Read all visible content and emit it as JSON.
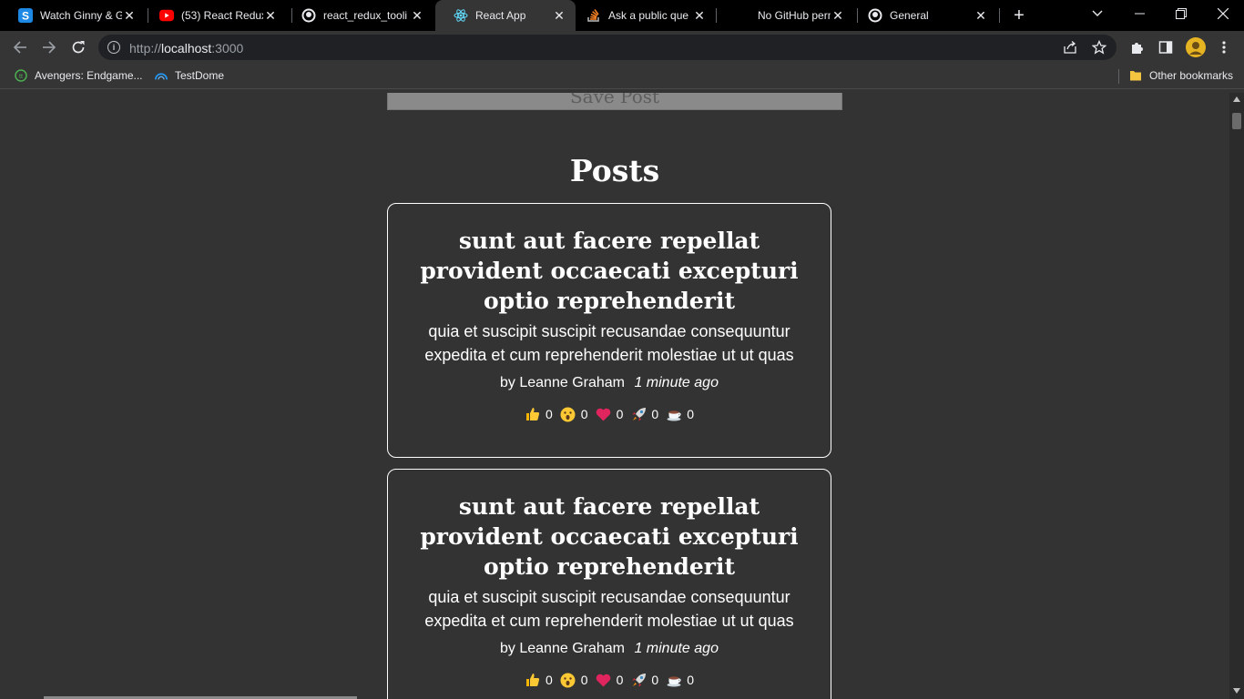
{
  "tabs": [
    {
      "title": "Watch Ginny & G",
      "icon": "s-logo-icon",
      "active": false
    },
    {
      "title": "(53) React Redux",
      "icon": "youtube-icon",
      "active": false
    },
    {
      "title": "react_redux_tooli",
      "icon": "github-icon",
      "active": false
    },
    {
      "title": "React App",
      "icon": "react-icon",
      "active": true
    },
    {
      "title": "Ask a public que",
      "icon": "stackoverflow-icon",
      "active": false
    },
    {
      "title": "No GitHub permi",
      "icon": "blank-icon",
      "active": false
    },
    {
      "title": "General",
      "icon": "github-icon",
      "active": false
    }
  ],
  "address_bar": {
    "scheme": "http://",
    "host": "localhost",
    "port": ":3000"
  },
  "bookmarks": [
    {
      "label": "Avengers: Endgame...",
      "icon": "bookmark-site-icon"
    },
    {
      "label": "TestDome",
      "icon": "testdome-icon"
    }
  ],
  "other_bookmarks": "Other bookmarks",
  "page": {
    "save_button": "Save Post",
    "section_title": "Posts",
    "posts": [
      {
        "title": "sunt aut facere repellat provident occaecati excepturi optio reprehenderit",
        "body": "quia et suscipit suscipit recusandae consequuntur expedita et cum reprehenderit molestiae ut ut quas",
        "author": "by Leanne Graham",
        "time": "1 minute ago",
        "reactions": [
          {
            "name": "thumbs-up",
            "count": "0"
          },
          {
            "name": "wow",
            "count": "0"
          },
          {
            "name": "heart",
            "count": "0"
          },
          {
            "name": "rocket",
            "count": "0"
          },
          {
            "name": "coffee",
            "count": "0"
          }
        ]
      },
      {
        "title": "sunt aut facere repellat provident occaecati excepturi optio reprehenderit",
        "body": "quia et suscipit suscipit recusandae consequuntur expedita et cum reprehenderit molestiae ut ut quas",
        "author": "by Leanne Graham",
        "time": "1 minute ago",
        "reactions": [
          {
            "name": "thumbs-up",
            "count": "0"
          },
          {
            "name": "wow",
            "count": "0"
          },
          {
            "name": "heart",
            "count": "0"
          },
          {
            "name": "rocket",
            "count": "0"
          },
          {
            "name": "coffee",
            "count": "0"
          }
        ]
      }
    ]
  },
  "colors": {
    "page_background": "#333333",
    "tabstrip_background": "#000000",
    "toolbar_background": "#353535",
    "card_border": "#ffffff",
    "text": "#ffffff"
  }
}
